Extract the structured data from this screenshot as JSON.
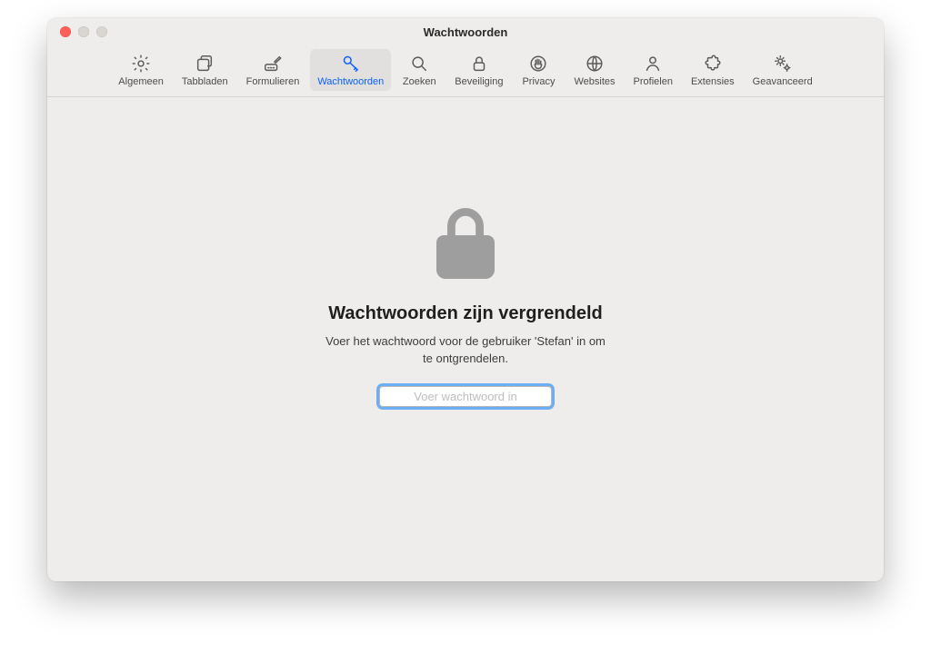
{
  "window": {
    "title": "Wachtwoorden"
  },
  "toolbar": {
    "items": [
      {
        "label": "Algemeen"
      },
      {
        "label": "Tabbladen"
      },
      {
        "label": "Formulieren"
      },
      {
        "label": "Wachtwoorden"
      },
      {
        "label": "Zoeken"
      },
      {
        "label": "Beveiliging"
      },
      {
        "label": "Privacy"
      },
      {
        "label": "Websites"
      },
      {
        "label": "Profielen"
      },
      {
        "label": "Extensies"
      },
      {
        "label": "Geavanceerd"
      }
    ],
    "selected_index": 3
  },
  "locked": {
    "title": "Wachtwoorden zijn vergrendeld",
    "subtitle": "Voer het wachtwoord voor de gebruiker 'Stefan' in om te ontgrendelen.",
    "placeholder": "Voer wachtwoord in"
  }
}
